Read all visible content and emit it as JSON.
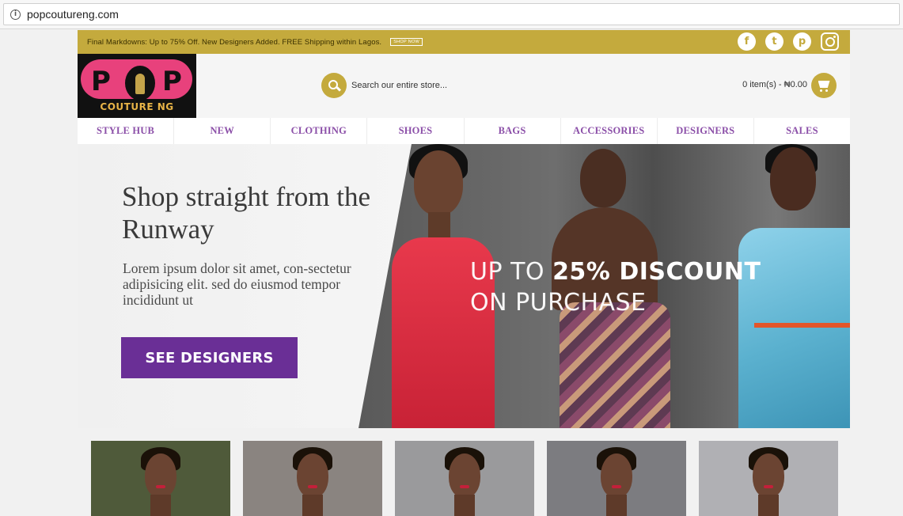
{
  "browser": {
    "url": "popcoutureng.com"
  },
  "promo": {
    "text": "Final Markdowns: Up to 75% Off. New Designers Added. FREE Shipping within Lagos.",
    "cta": "SHOP NOW"
  },
  "social": [
    {
      "icon": "facebook-icon",
      "glyph": "f"
    },
    {
      "icon": "twitter-icon",
      "glyph": "t"
    },
    {
      "icon": "pinterest-icon",
      "glyph": "p"
    },
    {
      "icon": "instagram-icon",
      "glyph": ""
    }
  ],
  "logo": {
    "letter_1": "P",
    "letter_2": "P",
    "sub": "COUTURE NG"
  },
  "search": {
    "placeholder": "Search our entire store..."
  },
  "cart": {
    "summary": "0 item(s) - ₦0.00"
  },
  "nav": {
    "items": [
      "STYLE HUB",
      "NEW",
      "CLOTHING",
      "SHOES",
      "BAGS",
      "ACCESSORIES",
      "DESIGNERS",
      "SALES"
    ]
  },
  "hero": {
    "title": "Shop straight from the Runway",
    "description": "Lorem ipsum dolor sit amet, con-sectetur adipisicing elit. sed do eiusmod tempor incididunt ut",
    "button": "SEE DESIGNERS",
    "offer_light_1": "UP TO ",
    "offer_strong": "25% DISCOUNT",
    "offer_light_2": "ON PURCHASE"
  },
  "thumbnails": [
    {
      "bg": "#4f5a3a"
    },
    {
      "bg": "#8a8480"
    },
    {
      "bg": "#9a9a9c"
    },
    {
      "bg": "#7c7c80"
    },
    {
      "bg": "#b0b0b4"
    }
  ],
  "colors": {
    "accent_gold": "#c4aa3d",
    "nav_purple": "#8b4fa8",
    "button_purple": "#6a2f96",
    "logo_pink": "#e8417c"
  }
}
